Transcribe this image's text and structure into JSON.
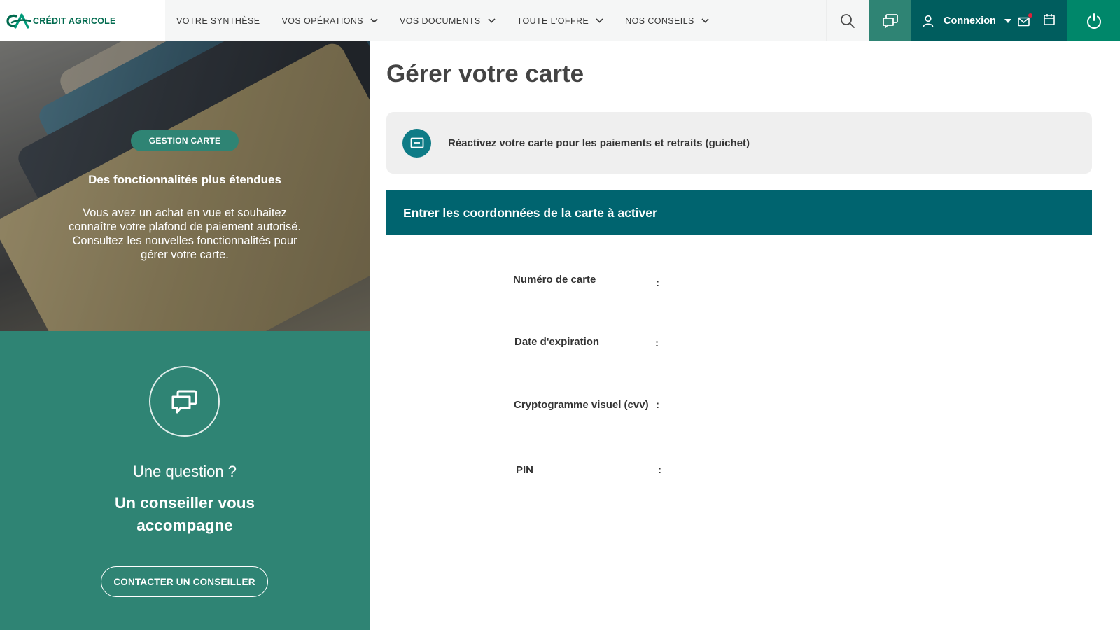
{
  "brand": {
    "logo_text": "CRÉDIT AGRICOLE",
    "primary_color": "#006a4e",
    "accent_color": "#2f8474",
    "dark_color": "#005d5e"
  },
  "nav": {
    "items": [
      {
        "label": "VOTRE SYNTHÈSE",
        "has_dropdown": false
      },
      {
        "label": "VOS OPÉRATIONS",
        "has_dropdown": true
      },
      {
        "label": "VOS DOCUMENTS",
        "has_dropdown": true
      },
      {
        "label": "TOUTE L'OFFRE",
        "has_dropdown": true
      },
      {
        "label": "NOS CONSEILS",
        "has_dropdown": true
      }
    ]
  },
  "toolbar": {
    "connexion_label": "Connexion",
    "icons": [
      "search-icon",
      "chat-icon",
      "user-icon",
      "mail-icon",
      "calendar-icon",
      "power-icon"
    ],
    "notification_color": "#e0203a"
  },
  "hero": {
    "badge": "GESTION CARTE",
    "title": "Des fonctionnalités plus étendues",
    "text": "Vous avez un achat en vue et souhaitez connaître votre plafond de paiement autorisé. Consultez les nouvelles fonctionnalités pour gérer votre carte."
  },
  "advisor": {
    "question": "Une question ?",
    "subtitle": "Un conseiller vous accompagne",
    "button_label": "CONTACTER UN CONSEILLER"
  },
  "main": {
    "page_title": "Gérer votre carte",
    "info_text": "Réactivez votre carte pour les paiements et retraits (guichet)",
    "form_title": "Entrer les coordonnées de la carte à activer",
    "fields": [
      {
        "label": "Numéro de carte",
        "separator": ":"
      },
      {
        "label": "Date d'expiration",
        "separator": ":"
      },
      {
        "label": "Cryptogramme visuel (cvv)",
        "separator": ":"
      },
      {
        "label": "PIN",
        "separator": ":"
      }
    ]
  }
}
